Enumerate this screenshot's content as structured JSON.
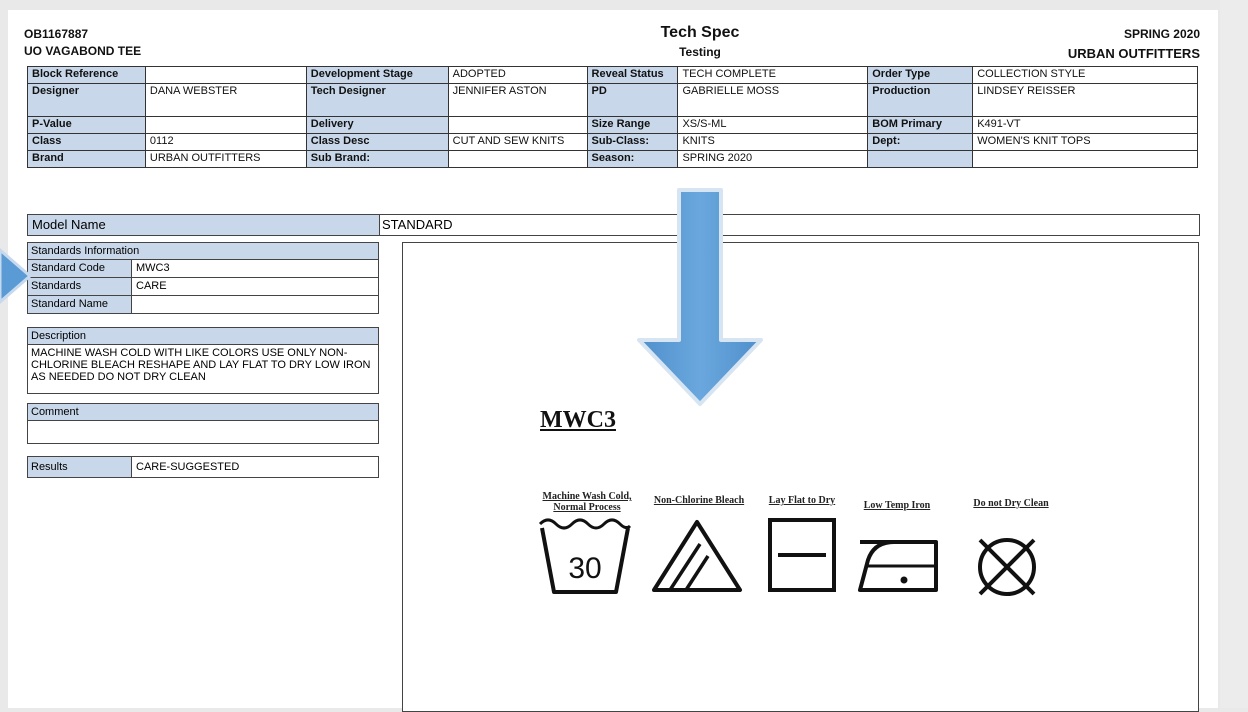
{
  "header": {
    "style_number": "OB1167887",
    "style_name": "UO VAGABOND TEE",
    "doc_title": "Tech Spec",
    "doc_subtitle": "Testing",
    "season": "SPRING 2020",
    "brand": "URBAN OUTFITTERS"
  },
  "spec": {
    "row1": {
      "l1": "Block Reference",
      "v1": "",
      "l2": "Development Stage",
      "v2": "ADOPTED",
      "l3": "Reveal Status",
      "v3": "TECH COMPLETE",
      "l4": "Order Type",
      "v4": "COLLECTION STYLE"
    },
    "row2": {
      "l1": "Designer",
      "v1": "DANA WEBSTER",
      "l2": "Tech Designer",
      "v2": "JENNIFER ASTON",
      "l3": "PD",
      "v3": "GABRIELLE MOSS",
      "l4": "Production",
      "v4": "LINDSEY REISSER"
    },
    "row3": {
      "l1": "P-Value",
      "v1": "",
      "l2": "Delivery",
      "v2": "",
      "l3": "Size Range",
      "v3": "XS/S-ML",
      "l4": "BOM Primary",
      "v4": "K491-VT"
    },
    "row4": {
      "l1": "Class",
      "v1": "0112",
      "l2": "Class Desc",
      "v2": "CUT AND SEW KNITS",
      "l3": "Sub-Class:",
      "v3": "KNITS",
      "l4": "Dept:",
      "v4": "WOMEN'S KNIT TOPS"
    },
    "row5": {
      "l1": "Brand",
      "v1": "URBAN OUTFITTERS",
      "l2": "Sub Brand:",
      "v2": "",
      "l3": "Season:",
      "v3": "SPRING 2020",
      "l4": "",
      "v4": ""
    }
  },
  "model": {
    "label": "Model Name",
    "value": "STANDARD"
  },
  "standards": {
    "title": "Standards Information",
    "code_label": "Standard Code",
    "code_value": "MWC3",
    "standards_label": "Standards",
    "standards_value": "CARE",
    "name_label": "Standard Name",
    "name_value": ""
  },
  "description": {
    "title": "Description",
    "text": "MACHINE WASH COLD WITH LIKE COLORS USE ONLY NON-CHLORINE BLEACH RESHAPE AND LAY FLAT TO DRY LOW IRON AS NEEDED DO NOT DRY CLEAN"
  },
  "comment": {
    "title": "Comment",
    "text": ""
  },
  "results": {
    "label": "Results",
    "value": "CARE-SUGGESTED"
  },
  "care_image": {
    "code": "MWC3",
    "wash_label_1": "Machine Wash Cold,",
    "wash_label_2": "Normal Process",
    "wash_temp": "30",
    "bleach_label": "Non-Chlorine Bleach",
    "dry_label": "Lay Flat to Dry",
    "iron_label": "Low Temp Iron",
    "dryclean_label": "Do not Dry Clean",
    "icons": [
      "wash-30-icon",
      "non-chlorine-bleach-icon",
      "lay-flat-dry-icon",
      "low-temp-iron-icon",
      "do-not-dry-clean-icon"
    ]
  },
  "colors": {
    "label_fill": "#c8d8ea",
    "arrow_fill": "#5b9bd5"
  }
}
